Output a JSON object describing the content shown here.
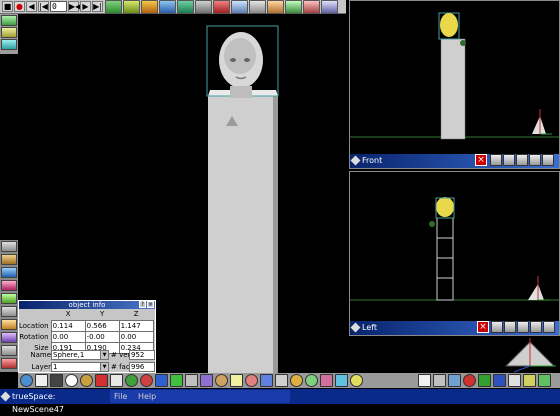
{
  "app": {
    "title": "trueSpace: NewScene47",
    "menu": [
      "File",
      "Help"
    ]
  },
  "toolbar": {
    "frame_value": "0",
    "play_controls": [
      "stop-icon",
      "record-icon",
      "first-frame-icon",
      "prev-frame-icon",
      "play-icon",
      "next-frame-icon",
      "last-frame-icon"
    ]
  },
  "views": {
    "front": {
      "label": "Front"
    },
    "left": {
      "label": "Left"
    }
  },
  "object_info": {
    "title": "object info",
    "columns": [
      "X",
      "Y",
      "Z"
    ],
    "rows": [
      {
        "label": "Location",
        "values": [
          "0.114",
          "0.566",
          "1.147"
        ]
      },
      {
        "label": "Rotation",
        "values": [
          "0.00",
          "-0.00",
          "0.00"
        ]
      },
      {
        "label": "Size",
        "values": [
          "0.191",
          "0.190",
          "0.234"
        ]
      }
    ],
    "name_label": "Name",
    "name_value": "Sphere,1",
    "vertices_label": "# ver",
    "vertices_value": "952",
    "layer_label": "Layer",
    "layer_value": "1",
    "faces_label": "# fac",
    "faces_value": "996"
  },
  "colors": {
    "title_bar": "#08246b",
    "toolbar_bg": "#c6c6c6",
    "viewport_bg": "#000000",
    "pillar": "#d0d0d0",
    "grid_line": "#2f7a2f"
  }
}
